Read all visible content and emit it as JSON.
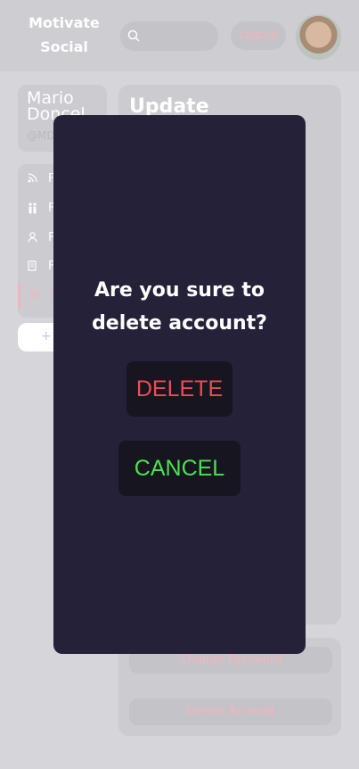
{
  "header": {
    "brand_line1": "Motivate",
    "brand_line2": "Social",
    "search_placeholder": "",
    "logout_label": "Logout"
  },
  "profile": {
    "name_line1": "Mario",
    "name_line2": "Doncel",
    "handle": "@MD"
  },
  "nav": {
    "items": [
      {
        "icon": "rss-icon",
        "label": "F"
      },
      {
        "icon": "people-icon",
        "label": "F"
      },
      {
        "icon": "user-icon",
        "label": "F"
      },
      {
        "icon": "document-icon",
        "label": "F"
      },
      {
        "icon": "gear-icon",
        "label": "S"
      }
    ],
    "post_button": "+"
  },
  "main": {
    "title": "Update",
    "change_password_label": "Change Password",
    "delete_account_label": "Delete Account"
  },
  "modal": {
    "question_line1": "Are you sure to",
    "question_line2": "delete account?",
    "delete_label": "DELETE",
    "cancel_label": "CANCEL"
  },
  "colors": {
    "modal_bg": "#252139",
    "delete_text": "#ef4b55",
    "cancel_text": "#49e34f",
    "accent_pink": "#f3b5bc"
  }
}
